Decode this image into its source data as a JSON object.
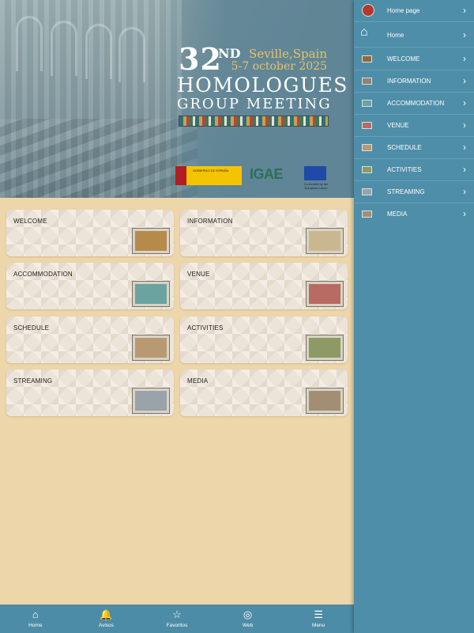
{
  "banner": {
    "edition_number": "32",
    "edition_suffix": "ND",
    "city": "Seville,Spain",
    "dates": "5-7 october 2025",
    "title_line1": "HOMOLOGUES",
    "title_line2": "GROUP MEETING",
    "logos": {
      "eu_caption": "Co-funded by the European Union",
      "ministry_caption": "GOBIERNO DE ESPAÑA",
      "igae": "IGAE"
    }
  },
  "tiles": [
    {
      "label": "WELCOME",
      "thumb_color": "#b58a4a"
    },
    {
      "label": "INFORMATION",
      "thumb_color": "#c9b88f"
    },
    {
      "label": "ACCOMMODATION",
      "thumb_color": "#6aa3a0"
    },
    {
      "label": "VENUE",
      "thumb_color": "#b96a62"
    },
    {
      "label": "SCHEDULE",
      "thumb_color": "#b79a72"
    },
    {
      "label": "ACTIVITIES",
      "thumb_color": "#8d9a66"
    },
    {
      "label": "STREAMING",
      "thumb_color": "#9aa2aa"
    },
    {
      "label": "MEDIA",
      "thumb_color": "#a28f73"
    }
  ],
  "tabbar": [
    {
      "label": "Home",
      "icon": "home-icon",
      "glyph": "⌂"
    },
    {
      "label": "Avisos",
      "icon": "bell-icon",
      "glyph": "🔔"
    },
    {
      "label": "Favoritos",
      "icon": "star-icon",
      "glyph": "☆"
    },
    {
      "label": "Web",
      "icon": "globe-icon",
      "glyph": "◎"
    },
    {
      "label": "Menu",
      "icon": "hamburger-icon",
      "glyph": "☰"
    }
  ],
  "sidemenu": [
    {
      "label": "Home page",
      "icon": "logo-icon"
    },
    {
      "label": "Home",
      "icon": "home-icon"
    },
    {
      "label": "WELCOME",
      "icon": "photo-icon"
    },
    {
      "label": "INFORMATION",
      "icon": "photo-icon"
    },
    {
      "label": "ACCOMMODATION",
      "icon": "photo-icon"
    },
    {
      "label": "VENUE",
      "icon": "photo-icon"
    },
    {
      "label": "SCHEDULE",
      "icon": "photo-icon"
    },
    {
      "label": "ACTIVITIES",
      "icon": "photo-icon"
    },
    {
      "label": "STREAMING",
      "icon": "photo-icon"
    },
    {
      "label": "MEDIA",
      "icon": "photo-icon"
    }
  ],
  "colors": {
    "menu_bg": "#4e8ea8",
    "tabbar_bg": "#4d8ca6",
    "main_bg": "#ecd6aa",
    "accent_gold": "#e6c36a"
  }
}
